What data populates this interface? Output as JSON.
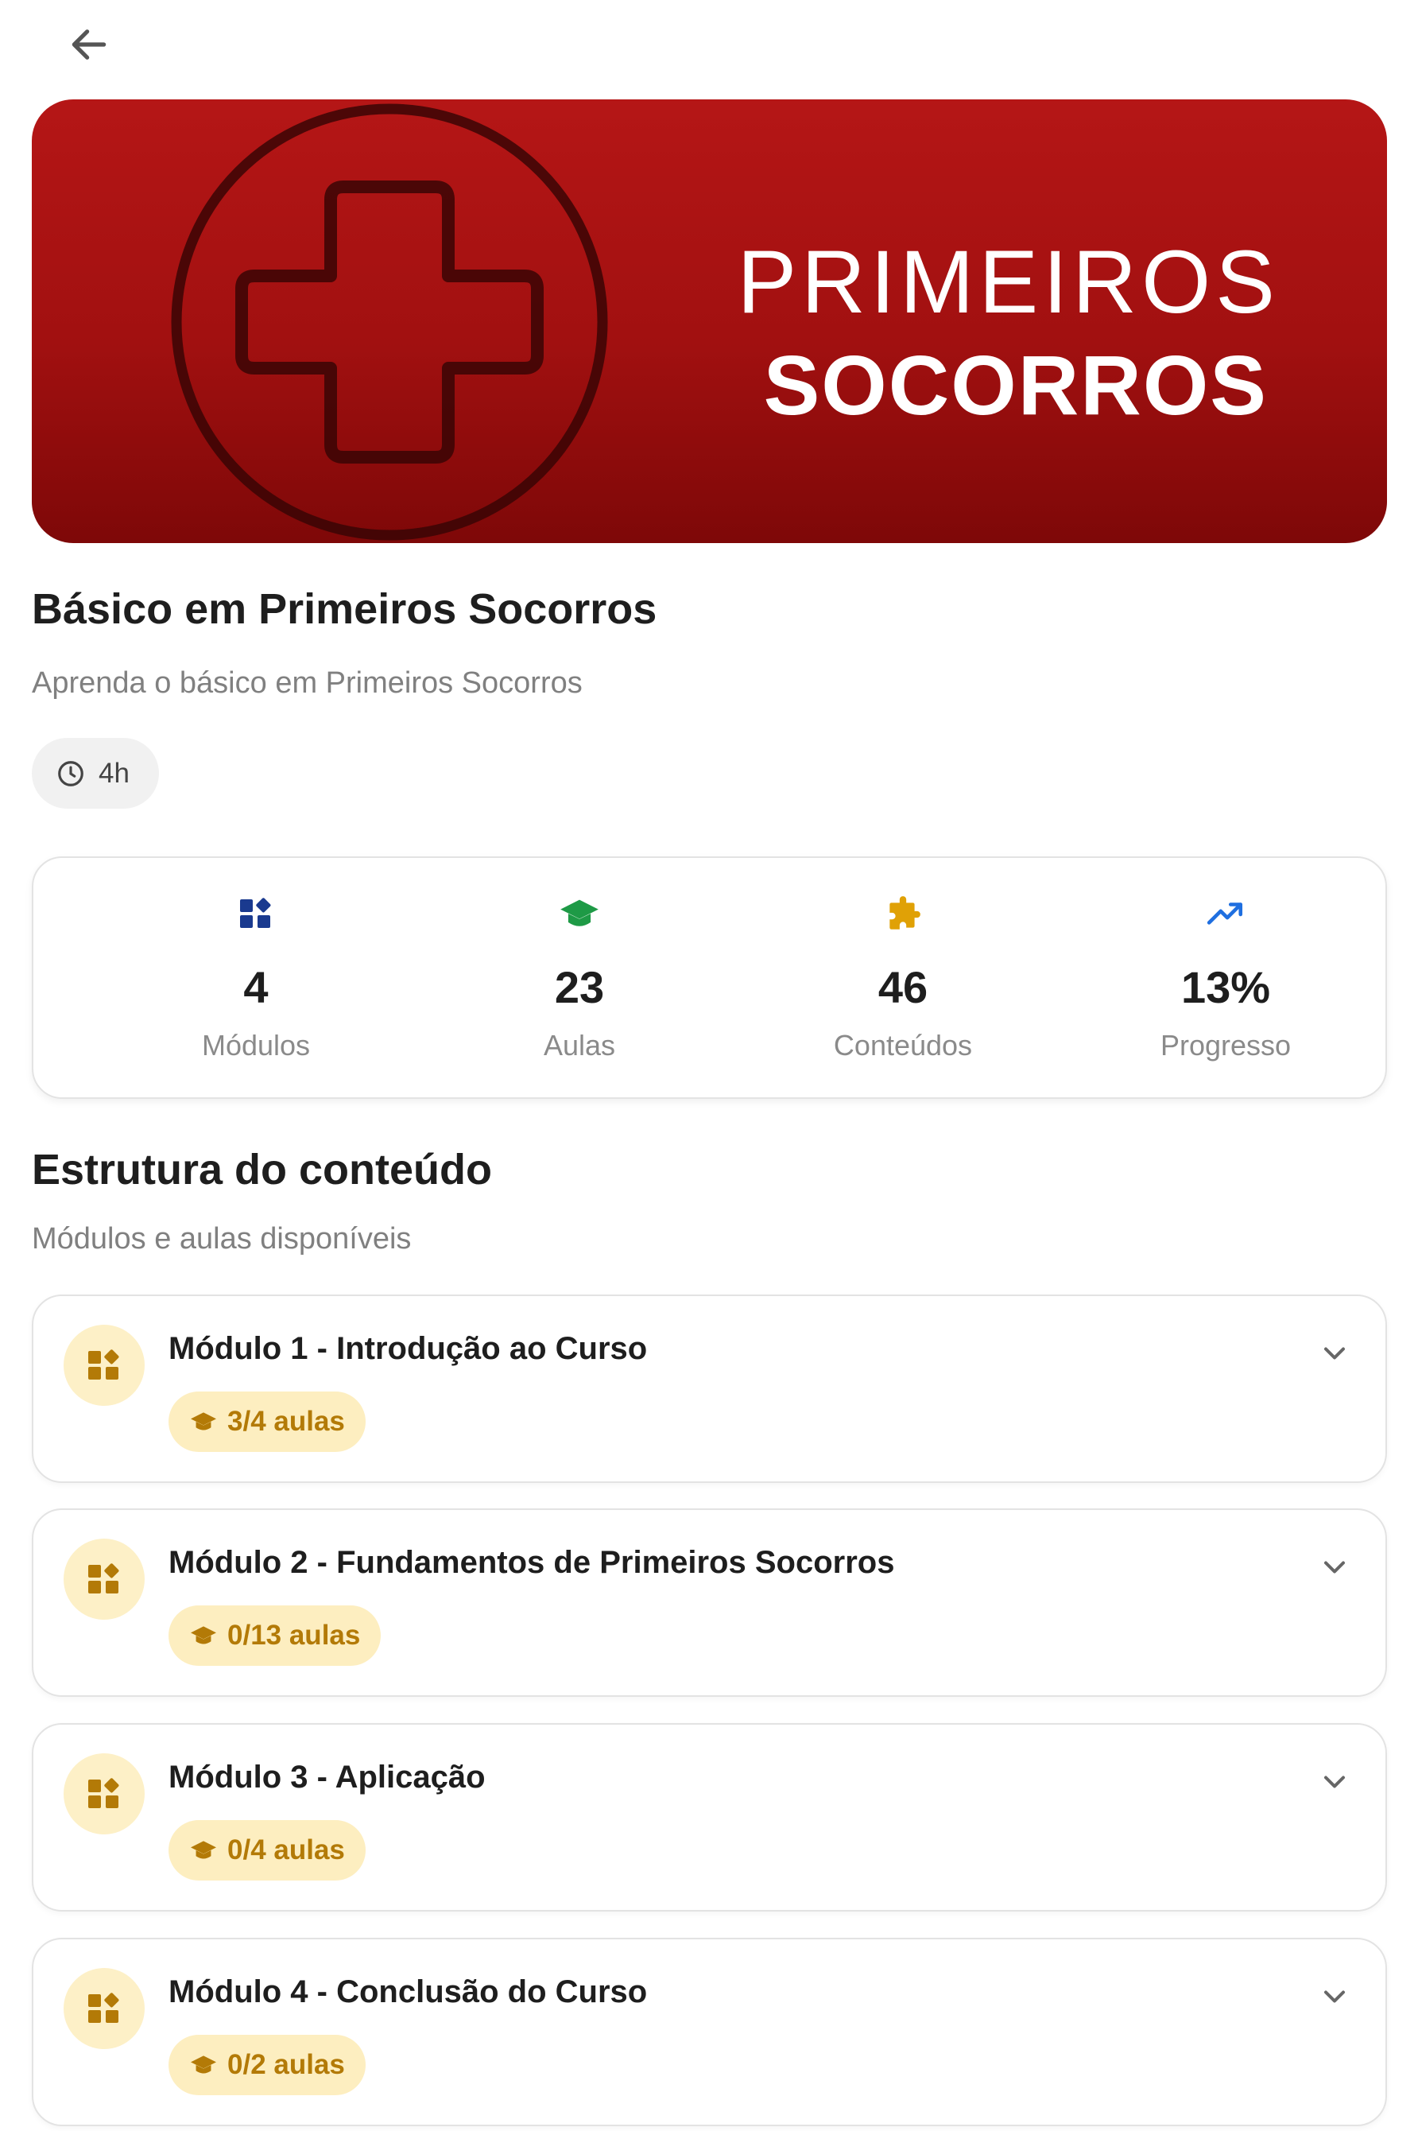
{
  "banner": {
    "line1": "PRIMEIROS",
    "line2": "SOCORROS"
  },
  "course": {
    "title": "Básico em Primeiros Socorros",
    "subtitle": "Aprenda o básico em Primeiros Socorros",
    "duration": "4h"
  },
  "stats": [
    {
      "value": "4",
      "label": "Módulos",
      "icon": "modules-icon",
      "color": "#1a3a8f"
    },
    {
      "value": "23",
      "label": "Aulas",
      "icon": "graduation-cap-icon",
      "color": "#1e9a46"
    },
    {
      "value": "46",
      "label": "Conteúdos",
      "icon": "puzzle-icon",
      "color": "#e0a106"
    },
    {
      "value": "13%",
      "label": "Progresso",
      "icon": "trending-up-icon",
      "color": "#1f6fe0"
    }
  ],
  "structure": {
    "title": "Estrutura do conteúdo",
    "subtitle": "Módulos e aulas disponíveis"
  },
  "modules": [
    {
      "title": "Módulo 1 - Introdução ao Curso",
      "lessons": "3/4 aulas"
    },
    {
      "title": "Módulo 2 - Fundamentos de Primeiros Socorros",
      "lessons": "0/13 aulas"
    },
    {
      "title": "Módulo 3 - Aplicação",
      "lessons": "0/4 aulas"
    },
    {
      "title": "Módulo 4 - Conclusão do Curso",
      "lessons": "0/2 aulas"
    }
  ],
  "colors": {
    "banner_red": "#a11010",
    "badge_bg": "#fdeec0",
    "badge_text": "#b37a07"
  }
}
